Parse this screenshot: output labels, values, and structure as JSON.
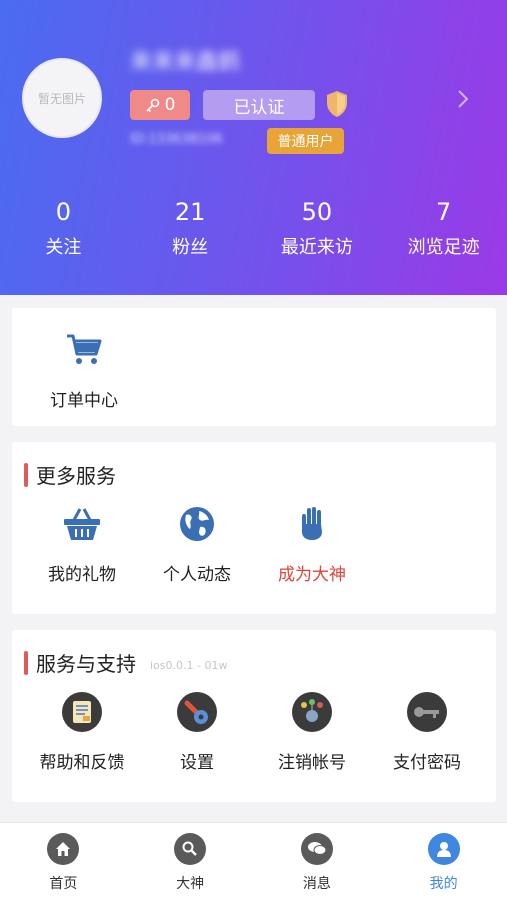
{
  "profile": {
    "avatar_placeholder": "暂无图片",
    "username": "来来来鑫鹤",
    "favorite_count": "0",
    "verified_label": "已认证",
    "user_id": "ID:133638106",
    "role_badge": "普通用户"
  },
  "stats": [
    {
      "value": "0",
      "label": "关注"
    },
    {
      "value": "21",
      "label": "粉丝"
    },
    {
      "value": "50",
      "label": "最近来访"
    },
    {
      "value": "7",
      "label": "浏览足迹"
    }
  ],
  "orders": {
    "label": "订单中心"
  },
  "more_services": {
    "title": "更多服务",
    "items": [
      {
        "label": "我的礼物",
        "icon": "basket-icon"
      },
      {
        "label": "个人动态",
        "icon": "globe-icon"
      },
      {
        "label": "成为大神",
        "icon": "hand-icon"
      }
    ]
  },
  "support": {
    "title": "服务与支持",
    "version": "ios0.0.1 - 01w",
    "items": [
      {
        "label": "帮助和反馈",
        "icon": "help-doc-icon"
      },
      {
        "label": "设置",
        "icon": "wrench-icon"
      },
      {
        "label": "注销帐号",
        "icon": "deregister-icon"
      },
      {
        "label": "支付密码",
        "icon": "key-icon"
      }
    ]
  },
  "tabs": [
    {
      "label": "首页",
      "icon": "home-icon"
    },
    {
      "label": "大神",
      "icon": "search-icon"
    },
    {
      "label": "消息",
      "icon": "chat-icon"
    },
    {
      "label": "我的",
      "icon": "user-icon"
    }
  ],
  "colors": {
    "accent": "#3f86e0",
    "header_start": "#4a6cf0",
    "header_end": "#9a3ae6",
    "highlight_red": "#e0443a",
    "section_bar": "#e05a5a"
  }
}
